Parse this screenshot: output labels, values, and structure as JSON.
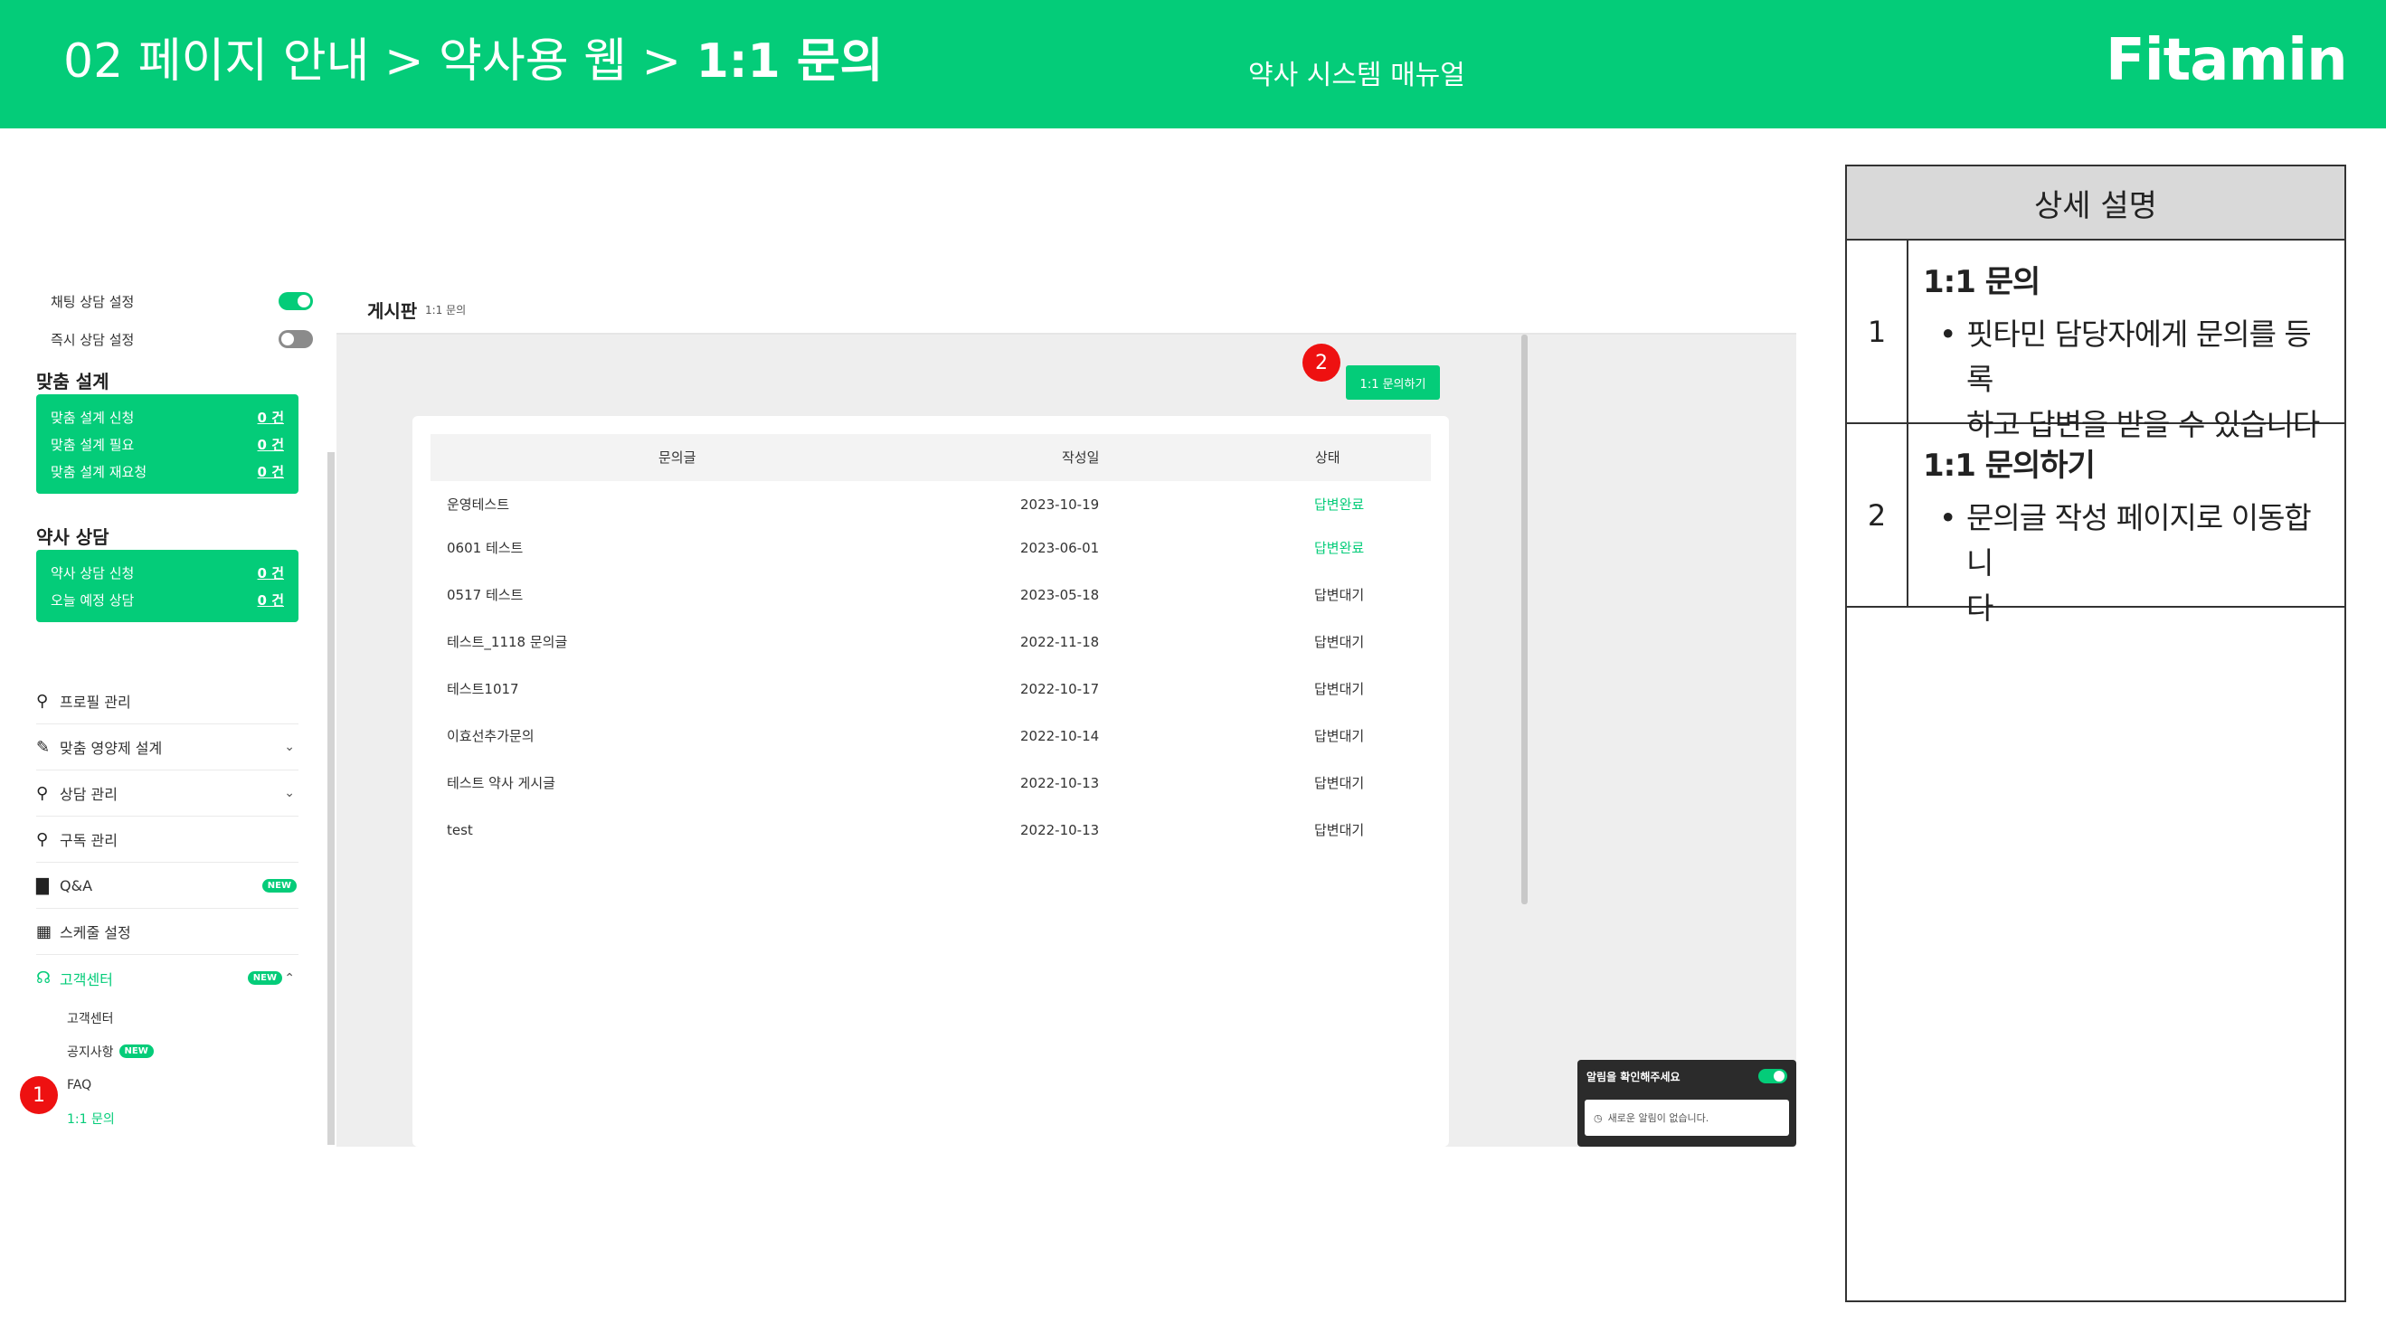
{
  "header": {
    "breadcrumb": "02 페이지 안내 > 약사용 웹 > ",
    "breadcrumb_current": "1:1 문의",
    "subtitle": "약사 시스템 매뉴얼",
    "logo": "Fitamin",
    "bg_color": "#04cc79"
  },
  "detail": {
    "heading": "상세 설명",
    "rows": [
      {
        "num": "1",
        "title": "1:1 문의",
        "bullet_1": "핏타민 담당자에게 문의를 등록",
        "bullet_2": "하고 답변을 받을 수 있습니다"
      },
      {
        "num": "2",
        "title": "1:1 문의하기",
        "bullet_1": "문의글 작성 페이지로 이동합니",
        "bullet_2": "다"
      }
    ]
  },
  "sidebar": {
    "chat_setting": "채팅 상담 설정",
    "chat_setting_on": true,
    "instant_setting": "즉시 상담 설정",
    "instant_setting_on": false,
    "custom_design": {
      "title": "맞춤 설계",
      "items": [
        {
          "label": "맞춤 설계 신청",
          "value": "0 건"
        },
        {
          "label": "맞춤 설계 필요",
          "value": "0 건"
        },
        {
          "label": "맞춤 설계 재요청",
          "value": "0 건"
        }
      ]
    },
    "pharmacist_consult": {
      "title": "약사 상담",
      "items": [
        {
          "label": "약사 상담 신청",
          "value": "0 건"
        },
        {
          "label": "오늘 예정 상담",
          "value": "0 건"
        }
      ]
    },
    "menu": [
      {
        "label": "프로필 관리",
        "icon": "person-icon"
      },
      {
        "label": "맞춤 영양제 설계",
        "icon": "pencil-icon"
      },
      {
        "label": "상담 관리",
        "icon": "person-icon"
      },
      {
        "label": "구독 관리",
        "icon": "person-icon"
      },
      {
        "label": "Q&A",
        "icon": "chat-icon",
        "badge": "NEW"
      },
      {
        "label": "스케줄 설정",
        "icon": "calendar-icon"
      },
      {
        "label": "고객센터",
        "icon": "headset-icon",
        "badge": "NEW"
      }
    ],
    "submenu": [
      {
        "label": "고객센터"
      },
      {
        "label": "공지사항",
        "badge": "NEW"
      },
      {
        "label": "FAQ"
      },
      {
        "label": "1:1 문의"
      }
    ]
  },
  "board": {
    "title": "게시판",
    "crumb": "1:1 문의",
    "write_button": "1:1 문의하기",
    "columns": [
      "문의글",
      "작성일",
      "상태"
    ],
    "rows": [
      {
        "title": "운영테스트",
        "date": "2023-10-19",
        "status": "답변완료"
      },
      {
        "title": "0601 테스트",
        "date": "2023-06-01",
        "status": "답변완료"
      },
      {
        "title": "0517 테스트",
        "date": "2023-05-18",
        "status": "답변대기"
      },
      {
        "title": "테스트_1118 문의글",
        "date": "2022-11-18",
        "status": "답변대기"
      },
      {
        "title": "테스트1017",
        "date": "2022-10-17",
        "status": "답변대기"
      },
      {
        "title": "이효선추가문의",
        "date": "2022-10-14",
        "status": "답변대기"
      },
      {
        "title": "테스트 약사 게시글",
        "date": "2022-10-13",
        "status": "답변대기"
      },
      {
        "title": "test",
        "date": "2022-10-13",
        "status": "답변대기"
      }
    ]
  },
  "notification": {
    "title": "알림을 확인해주세요",
    "enabled": true,
    "message": "새로운 알림이 없습니다."
  },
  "markers": [
    "1",
    "2"
  ]
}
